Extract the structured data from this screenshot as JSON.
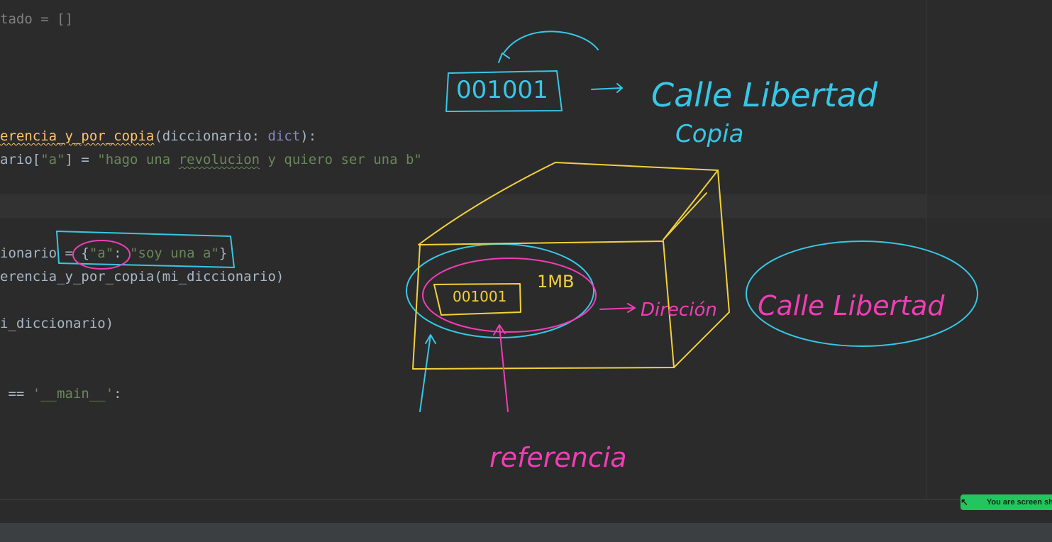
{
  "code_lines": {
    "l1": {
      "a": "tado = []"
    },
    "l2": {
      "fn": "erencia_y_por_copia",
      "p1": "(diccionario: ",
      "type": "dict",
      "p2": "):"
    },
    "l3": {
      "a": "ario[",
      "s1": "\"a\"",
      "b": "] = ",
      "s2a": "\"hago una ",
      "s2b": "revolucion",
      "s2c": " y quiero ser una b\""
    },
    "l4": {
      "a": "ionario = {",
      "s1": "\"a\"",
      "b": ": ",
      "s2": "\"soy una a\"",
      "c": "}"
    },
    "l5": {
      "fn": "erencia_y_por_copia",
      "a": "(mi_diccionario)"
    },
    "l6": {
      "a": "i_diccionario)"
    },
    "l7": {
      "a": " == ",
      "s": "'__main__'",
      "b": ":"
    }
  },
  "annotations": {
    "address_top": "001001",
    "street_top": "Calle Libertad",
    "copy_label": "Copia",
    "memory_size": "1MB",
    "address_inner": "001001",
    "direction_label": "Direción",
    "street_right": "Calle Libertad",
    "reference_label": "referencia"
  },
  "colors": {
    "cyan_ink": "#37c7e6",
    "yellow_ink": "#f2d13a",
    "pink_ink": "#f23db5"
  },
  "status": {
    "share_text": "You are screen sharing",
    "share_icon": "arrow-icon"
  }
}
